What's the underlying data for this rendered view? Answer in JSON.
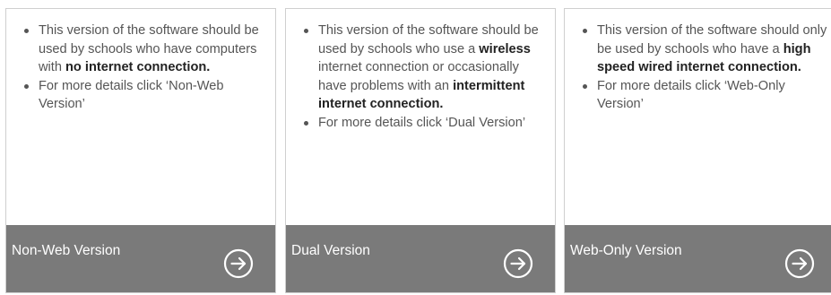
{
  "colors": {
    "footer_bg": "#7a7a7a",
    "card_border": "#cfcfcf",
    "body_text": "#555555",
    "bold_text": "#222222",
    "footer_text": "#ffffff"
  },
  "cards": [
    {
      "bullet1": {
        "pre": "This version of the software should be used by schools who have computers with ",
        "bold": "no internet connection.",
        "post": ""
      },
      "bullet2": "For more details click ‘Non-Web Version’",
      "footer_label": "Non-Web Version",
      "footer_icon": "arrow-right-circle-icon"
    },
    {
      "bullet1": {
        "pre": "This version of the software should be used by schools who use a ",
        "bold": "wireless",
        "mid": " internet connection or occasionally have problems with an ",
        "bold2": "intermittent internet connection."
      },
      "bullet2": "For more details click ‘Dual Version’",
      "footer_label": "Dual Version",
      "footer_icon": "arrow-right-circle-icon"
    },
    {
      "bullet1": {
        "pre": "This version of the software should only be used by schools who have a ",
        "bold": "high speed wired internet connection.",
        "post": ""
      },
      "bullet2": "For more details click ‘Web-Only Version’",
      "footer_label": "Web-Only Version",
      "footer_icon": "arrow-right-circle-icon"
    }
  ]
}
